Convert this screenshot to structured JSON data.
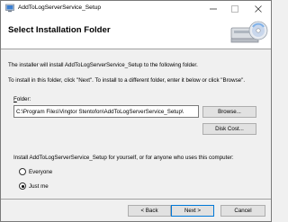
{
  "window": {
    "title": "AddToLogServerService_Setup"
  },
  "banner": {
    "title": "Select Installation Folder"
  },
  "body": {
    "intro": "The installer will install AddToLogServerService_Setup to the following folder.",
    "instructions": "To install in this folder, click \"Next\". To install to a different folder, enter it below or click \"Browse\".",
    "folder_label": "Folder:",
    "folder_value": "C:\\Program Files\\Vingtor Stentofon\\AddToLogServerService_Setup\\",
    "browse_label": "Browse...",
    "disk_cost_label": "Disk Cost...",
    "install_for_label": "Install AddToLogServerService_Setup for yourself, or for anyone who uses this computer:",
    "options": [
      {
        "label": "Everyone",
        "selected": false
      },
      {
        "label": "Just me",
        "selected": true
      }
    ]
  },
  "footer": {
    "back_label": "< Back",
    "next_label": "Next >",
    "cancel_label": "Cancel"
  },
  "icons": {
    "app": "installer-app-icon",
    "banner": "computer-disc-icon",
    "minimize": "minimize-icon",
    "maximize": "maximize-icon",
    "close": "close-icon"
  },
  "colors": {
    "dialog_bg": "#f0f0f0",
    "banner_bg": "#ffffff",
    "default_button_border": "#0078d7"
  }
}
